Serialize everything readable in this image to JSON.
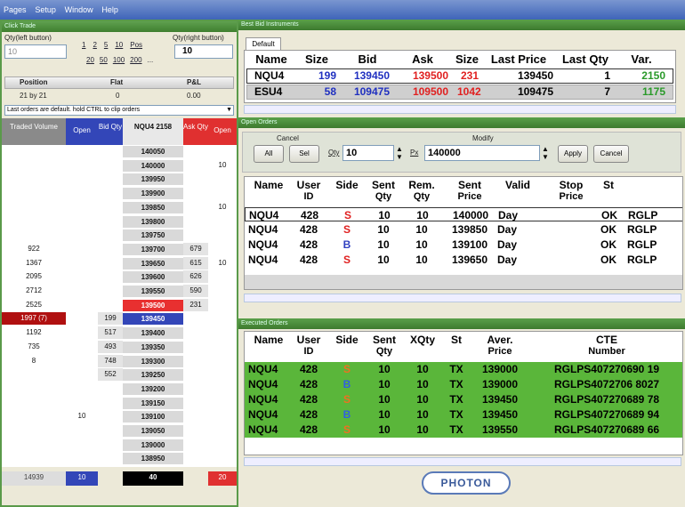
{
  "menu": [
    "Pages",
    "Setup",
    "Window",
    "Help"
  ],
  "ladder": {
    "title": "Click Trade",
    "qty_label": "Qty(left button)",
    "qty_buttons": [
      "1",
      "2",
      "5",
      "10",
      "Pos"
    ],
    "qty_buttons2": [
      "20",
      "50",
      "100",
      "200",
      "..."
    ],
    "qty_right_label": "Qty(right button)",
    "qty_value": "10",
    "qty_right_value": "10",
    "pos_headers": [
      "Position",
      "Flat",
      "P&L"
    ],
    "pos_values": [
      "21 by 21",
      "0",
      "0.00"
    ],
    "note": "Last orders are default. hold CTRL to clip orders",
    "col_headers": [
      "Traded Volume",
      "Open",
      "Bid Qty",
      "NQU4 2158",
      "Ask Qty",
      "Open"
    ],
    "rows": [
      [
        "",
        "",
        "",
        "140050",
        "",
        ""
      ],
      [
        "",
        "",
        "",
        "140000",
        "",
        "10"
      ],
      [
        "",
        "",
        "",
        "139950",
        "",
        ""
      ],
      [
        "",
        "",
        "",
        "139900",
        "",
        ""
      ],
      [
        "",
        "",
        "",
        "139850",
        "",
        "10"
      ],
      [
        "",
        "",
        "",
        "139800",
        "",
        ""
      ],
      [
        "",
        "",
        "",
        "139750",
        "",
        ""
      ],
      [
        "922",
        "",
        "",
        "139700",
        "679",
        ""
      ],
      [
        "1367",
        "",
        "",
        "139650",
        "615",
        "10"
      ],
      [
        "2095",
        "",
        "",
        "139600",
        "626",
        ""
      ],
      [
        "2712",
        "",
        "",
        "139550",
        "590",
        ""
      ],
      [
        "2525",
        "",
        "",
        "139500",
        "231",
        ""
      ],
      [
        "1997 (7)",
        "",
        "199",
        "139450",
        "",
        ""
      ],
      [
        "1192",
        "",
        "517",
        "139400",
        "",
        ""
      ],
      [
        "735",
        "",
        "493",
        "139350",
        "",
        ""
      ],
      [
        "8",
        "",
        "748",
        "139300",
        "",
        ""
      ],
      [
        "",
        "",
        "552",
        "139250",
        "",
        ""
      ],
      [
        "",
        "",
        "",
        "139200",
        "",
        ""
      ],
      [
        "",
        "",
        "",
        "139150",
        "",
        ""
      ],
      [
        "",
        "10",
        "",
        "139100",
        "",
        ""
      ],
      [
        "",
        "",
        "",
        "139050",
        "",
        ""
      ],
      [
        "",
        "",
        "",
        "139000",
        "",
        ""
      ],
      [
        "",
        "",
        "",
        "138950",
        "",
        ""
      ]
    ],
    "footer": [
      "14939",
      "10",
      "",
      "40",
      "",
      "20"
    ]
  },
  "best": {
    "title": "Best Bid Instruments",
    "tab": "Default",
    "headers": [
      "Name",
      "Size",
      "Bid",
      "Ask",
      "Size",
      "Last Price",
      "Last Qty",
      "Var."
    ],
    "rows": [
      [
        "NQU4",
        "199",
        "139450",
        "139500",
        "231",
        "139450",
        "1",
        "2150"
      ],
      [
        "ESU4",
        "58",
        "109475",
        "109500",
        "1042",
        "109475",
        "7",
        "1175"
      ]
    ]
  },
  "orders": {
    "title": "Open Orders",
    "cancel_label": "Cancel",
    "modify_label": "Modify",
    "all_btn": "All",
    "sel_btn": "Sel",
    "qty_label": "Qty",
    "qty_value": "10",
    "price_label": "Px",
    "price_value": "140000",
    "apply_btn": "Apply",
    "cancel_btn": "Cancel",
    "headers": [
      [
        "Name",
        ""
      ],
      [
        "User",
        "ID"
      ],
      [
        "Side",
        ""
      ],
      [
        "Sent",
        "Qty"
      ],
      [
        "Rem.",
        "Qty"
      ],
      [
        "Sent",
        "Price"
      ],
      [
        "Valid",
        ""
      ],
      [
        "Stop",
        "Price"
      ],
      [
        "St",
        ""
      ]
    ],
    "rows": [
      [
        "NQU4",
        "428",
        "S",
        "10",
        "10",
        "140000",
        "Day",
        "",
        "OK",
        "RGLP"
      ],
      [
        "NQU4",
        "428",
        "S",
        "10",
        "10",
        "139850",
        "Day",
        "",
        "OK",
        "RGLP"
      ],
      [
        "NQU4",
        "428",
        "B",
        "10",
        "10",
        "139100",
        "Day",
        "",
        "OK",
        "RGLP"
      ],
      [
        "NQU4",
        "428",
        "S",
        "10",
        "10",
        "139650",
        "Day",
        "",
        "OK",
        "RGLP"
      ]
    ]
  },
  "executed": {
    "title": "Executed Orders",
    "headers": [
      [
        "Name",
        ""
      ],
      [
        "User",
        "ID"
      ],
      [
        "Side",
        ""
      ],
      [
        "Sent",
        "Qty"
      ],
      [
        "XQty",
        ""
      ],
      [
        "St",
        ""
      ],
      [
        "Aver.",
        "Price"
      ],
      [
        "CTE",
        "Number"
      ]
    ],
    "rows": [
      [
        "NQU4",
        "428",
        "S",
        "10",
        "10",
        "TX",
        "139000",
        "RGLPS407270690 19"
      ],
      [
        "NQU4",
        "428",
        "B",
        "10",
        "10",
        "TX",
        "139000",
        "RGLPS4072706 8027"
      ],
      [
        "NQU4",
        "428",
        "S",
        "10",
        "10",
        "TX",
        "139450",
        "RGLPS407270689 78"
      ],
      [
        "NQU4",
        "428",
        "B",
        "10",
        "10",
        "TX",
        "139450",
        "RGLPS407270689 94"
      ],
      [
        "NQU4",
        "428",
        "S",
        "10",
        "10",
        "TX",
        "139550",
        "RGLPS407270689 66"
      ]
    ]
  },
  "logo": "PHOTON"
}
